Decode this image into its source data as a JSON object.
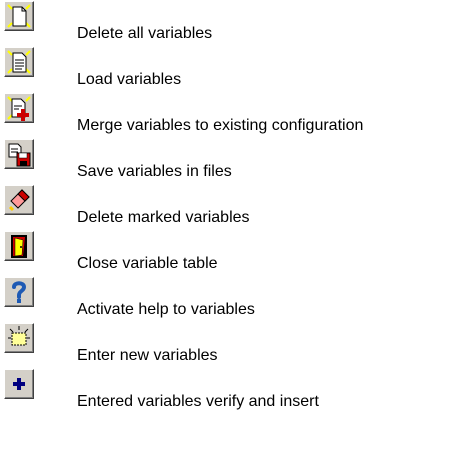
{
  "toolbar_help": {
    "items": [
      {
        "icon": "delete-all-icon",
        "label": "Delete all variables"
      },
      {
        "icon": "load-variables-icon",
        "label": "Load variables"
      },
      {
        "icon": "merge-variables-icon",
        "label": "Merge variables to existing configuration"
      },
      {
        "icon": "save-variables-icon",
        "label": "Save variables in files"
      },
      {
        "icon": "eraser-icon",
        "label": "Delete marked variables"
      },
      {
        "icon": "close-door-icon",
        "label": "Close variable table"
      },
      {
        "icon": "help-question-icon",
        "label": "Activate help to variables"
      },
      {
        "icon": "new-variable-icon",
        "label": "Enter new variables"
      },
      {
        "icon": "plus-icon",
        "label": "Entered variables verify and insert"
      }
    ]
  },
  "colors": {
    "button_face": "#d4d0c8",
    "spark_yellow": "#ffff00",
    "accent_red": "#cc0000",
    "help_blue": "#1e5ab4",
    "plus_navy": "#000080"
  }
}
